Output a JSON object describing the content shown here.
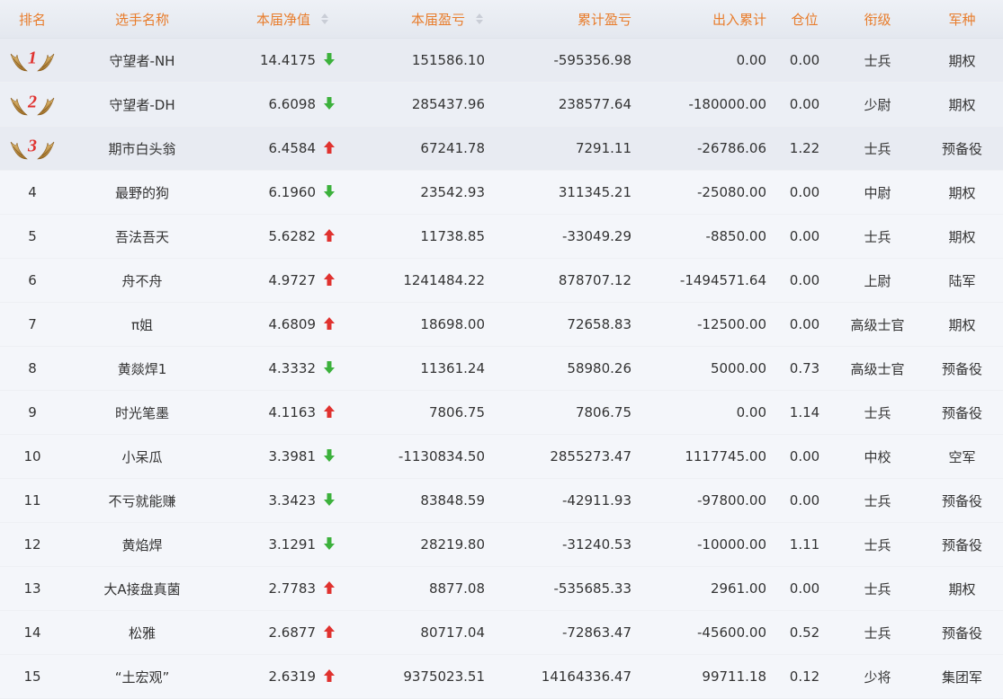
{
  "header": {
    "rank": "排名",
    "name": "选手名称",
    "nav": "本届净值",
    "pnl": "本届盈亏",
    "cum_pnl": "累计盈亏",
    "flow": "出入累计",
    "position": "仓位",
    "title": "衔级",
    "arm": "军种"
  },
  "colors": {
    "header_text": "#e87c2b",
    "up_arrow": "#e0322f",
    "down_arrow": "#3cb13c",
    "medal_number": "#e0322f"
  },
  "rows": [
    {
      "rank": "1",
      "name": "守望者-NH",
      "nav": "14.4175",
      "trend": "down",
      "pnl": "151586.10",
      "cum_pnl": "-595356.98",
      "flow": "0.00",
      "position": "0.00",
      "title": "士兵",
      "arm": "期权"
    },
    {
      "rank": "2",
      "name": "守望者-DH",
      "nav": "6.6098",
      "trend": "down",
      "pnl": "285437.96",
      "cum_pnl": "238577.64",
      "flow": "-180000.00",
      "position": "0.00",
      "title": "少尉",
      "arm": "期权"
    },
    {
      "rank": "3",
      "name": "期市白头翁",
      "nav": "6.4584",
      "trend": "up",
      "pnl": "67241.78",
      "cum_pnl": "7291.11",
      "flow": "-26786.06",
      "position": "1.22",
      "title": "士兵",
      "arm": "预备役"
    },
    {
      "rank": "4",
      "name": "最野的狗",
      "nav": "6.1960",
      "trend": "down",
      "pnl": "23542.93",
      "cum_pnl": "311345.21",
      "flow": "-25080.00",
      "position": "0.00",
      "title": "中尉",
      "arm": "期权"
    },
    {
      "rank": "5",
      "name": "吾法吾天",
      "nav": "5.6282",
      "trend": "up",
      "pnl": "11738.85",
      "cum_pnl": "-33049.29",
      "flow": "-8850.00",
      "position": "0.00",
      "title": "士兵",
      "arm": "期权"
    },
    {
      "rank": "6",
      "name": "舟不舟",
      "nav": "4.9727",
      "trend": "up",
      "pnl": "1241484.22",
      "cum_pnl": "878707.12",
      "flow": "-1494571.64",
      "position": "0.00",
      "title": "上尉",
      "arm": "陆军"
    },
    {
      "rank": "7",
      "name": "π姐",
      "nav": "4.6809",
      "trend": "up",
      "pnl": "18698.00",
      "cum_pnl": "72658.83",
      "flow": "-12500.00",
      "position": "0.00",
      "title": "高级士官",
      "arm": "期权"
    },
    {
      "rank": "8",
      "name": "黄燚焊1",
      "nav": "4.3332",
      "trend": "down",
      "pnl": "11361.24",
      "cum_pnl": "58980.26",
      "flow": "5000.00",
      "position": "0.73",
      "title": "高级士官",
      "arm": "预备役"
    },
    {
      "rank": "9",
      "name": "时光笔墨",
      "nav": "4.1163",
      "trend": "up",
      "pnl": "7806.75",
      "cum_pnl": "7806.75",
      "flow": "0.00",
      "position": "1.14",
      "title": "士兵",
      "arm": "预备役"
    },
    {
      "rank": "10",
      "name": "小呆瓜",
      "nav": "3.3981",
      "trend": "down",
      "pnl": "-1130834.50",
      "cum_pnl": "2855273.47",
      "flow": "1117745.00",
      "position": "0.00",
      "title": "中校",
      "arm": "空军"
    },
    {
      "rank": "11",
      "name": "不亏就能赚",
      "nav": "3.3423",
      "trend": "down",
      "pnl": "83848.59",
      "cum_pnl": "-42911.93",
      "flow": "-97800.00",
      "position": "0.00",
      "title": "士兵",
      "arm": "预备役"
    },
    {
      "rank": "12",
      "name": "黄焰焊",
      "nav": "3.1291",
      "trend": "down",
      "pnl": "28219.80",
      "cum_pnl": "-31240.53",
      "flow": "-10000.00",
      "position": "1.11",
      "title": "士兵",
      "arm": "预备役"
    },
    {
      "rank": "13",
      "name": "大A接盘真菌",
      "nav": "2.7783",
      "trend": "up",
      "pnl": "8877.08",
      "cum_pnl": "-535685.33",
      "flow": "2961.00",
      "position": "0.00",
      "title": "士兵",
      "arm": "期权"
    },
    {
      "rank": "14",
      "name": "松雅",
      "nav": "2.6877",
      "trend": "up",
      "pnl": "80717.04",
      "cum_pnl": "-72863.47",
      "flow": "-45600.00",
      "position": "0.52",
      "title": "士兵",
      "arm": "预备役"
    },
    {
      "rank": "15",
      "name": "“土宏观”",
      "nav": "2.6319",
      "trend": "up",
      "pnl": "9375023.51",
      "cum_pnl": "14164336.47",
      "flow": "99711.18",
      "position": "0.12",
      "title": "少将",
      "arm": "集团军"
    }
  ]
}
